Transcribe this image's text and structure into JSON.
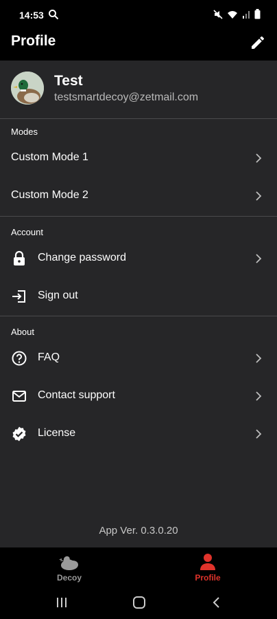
{
  "status_bar": {
    "time": "14:53",
    "icons": [
      "search-icon",
      "mute-icon",
      "wifi-icon",
      "signal-icon",
      "battery-icon"
    ]
  },
  "header": {
    "title": "Profile",
    "edit_icon": "pencil-icon"
  },
  "profile": {
    "name": "Test",
    "email": "testsmartdecoy@zetmail.com",
    "avatar_icon": "duck-avatar"
  },
  "sections": {
    "modes": {
      "label": "Modes",
      "items": [
        {
          "label": "Custom Mode 1",
          "icon": ""
        },
        {
          "label": "Custom Mode 2",
          "icon": ""
        }
      ]
    },
    "account": {
      "label": "Account",
      "items": [
        {
          "label": "Change password",
          "icon": "lock-icon"
        },
        {
          "label": "Sign out",
          "icon": "sign-out-icon"
        }
      ]
    },
    "about": {
      "label": "About",
      "items": [
        {
          "label": "FAQ",
          "icon": "question-circle-icon"
        },
        {
          "label": "Contact support",
          "icon": "mail-icon"
        },
        {
          "label": "License",
          "icon": "verified-badge-icon"
        }
      ]
    }
  },
  "app_version": "App Ver. 0.3.0.20",
  "bottom_nav": {
    "tabs": [
      {
        "label": "Decoy",
        "icon": "duck-icon",
        "active": false
      },
      {
        "label": "Profile",
        "icon": "person-icon",
        "active": true
      }
    ]
  },
  "colors": {
    "background": "#262628",
    "bar": "#000000",
    "accent": "#e0332b",
    "divider": "#4a4a4c"
  }
}
